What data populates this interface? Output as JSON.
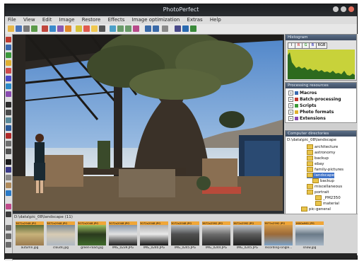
{
  "window": {
    "title": "PhotoPerfect"
  },
  "menu": [
    "File",
    "View",
    "Edit",
    "Image",
    "Restore",
    "Effects",
    "Image optimization",
    "Extras",
    "Help"
  ],
  "histogram": {
    "header": "Histogram",
    "channels": [
      "I",
      "R",
      "G",
      "B",
      "RGB"
    ]
  },
  "processing": {
    "header": "Processing resources",
    "items": [
      "Macros",
      "Batch-processing",
      "Scripts",
      "Photo formats",
      "Extensions"
    ]
  },
  "directories": {
    "header": "Computer directories",
    "path": "D:\\data\\pic_08\\landscape",
    "folders": [
      "architecture",
      "astronomy",
      "backup",
      "ebay",
      "family-pictures",
      "landscape",
      "backup",
      "miscellaneous",
      "portrait",
      "_PM2350",
      "material",
      "pic-general"
    ],
    "selected_index": 5
  },
  "thumbnails": {
    "path": "D:\\data\\pic_08\\landscape (11)",
    "items": [
      {
        "dims": "3872x2948 JPG",
        "name": "autumn.jpg",
        "colors": [
          "#9a7a4f",
          "#5b6c3a",
          "#c7b27a"
        ]
      },
      {
        "dims": "3872x2948 JPG",
        "name": "clouds.jpg",
        "colors": [
          "#aeb8c2",
          "#7b8a96",
          "#d7cbb3"
        ]
      },
      {
        "dims": "3072x2048 JPG",
        "name": "green-road.jpg",
        "colors": [
          "#3f6a2a",
          "#9fc263",
          "#2a3a1e"
        ]
      },
      {
        "dims": "3072x2048 JPG",
        "name": "IMG_0239.JPG",
        "colors": [
          "#1b1b1b",
          "#8a97a8",
          "#e2e2e2"
        ]
      },
      {
        "dims": "3072x2048 JPG",
        "name": "IMG_0240.JPG",
        "colors": [
          "#111111",
          "#b0b0b0",
          "#e8e8e8"
        ]
      },
      {
        "dims": "3072x2048 JPG",
        "name": "IMG_0245.JPG",
        "colors": [
          "#2b2d2a",
          "#b9c0c6",
          "#505050"
        ]
      },
      {
        "dims": "3872x2592 JPG",
        "name": "IMG_0244.JPG",
        "colors": [
          "#2a2a2a",
          "#d8d8d8",
          "#6d6d6d"
        ]
      },
      {
        "dims": "3872x2592 JPG",
        "name": "IMG_0245.JPG",
        "colors": [
          "#1e1e1e",
          "#c2c8cf",
          "#5e5e5e"
        ]
      },
      {
        "dims": "3872x2592 JPG",
        "name": "recording-single...",
        "colors": [
          "#7aa2c8",
          "#d39a4a",
          "#9c6a38"
        ]
      },
      {
        "dims": "1600x961 JPG",
        "name": "snow.jpg",
        "colors": [
          "#a8b7c6",
          "#e8eef2",
          "#6b7a88"
        ]
      }
    ]
  },
  "colors": {
    "accent": "#f0a638",
    "selection": "#3f73c8",
    "histogram": "#c8d23a"
  }
}
